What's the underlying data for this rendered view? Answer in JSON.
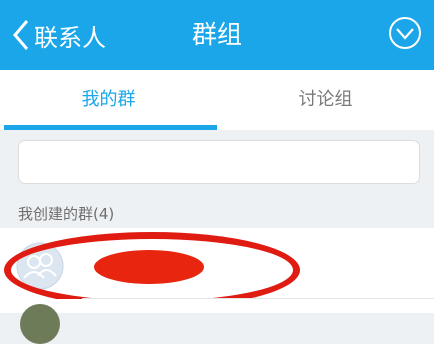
{
  "header": {
    "back_label": "联系人",
    "title": "群组"
  },
  "tabs": [
    {
      "label": "我的群",
      "active": true
    },
    {
      "label": "讨论组",
      "active": false
    }
  ],
  "search": {
    "placeholder": ""
  },
  "section": {
    "label": "我创建的群(4)"
  },
  "groups": [
    {
      "name": ""
    }
  ],
  "colors": {
    "accent": "#1aa6e8",
    "annotation_red": "#e01c12"
  }
}
